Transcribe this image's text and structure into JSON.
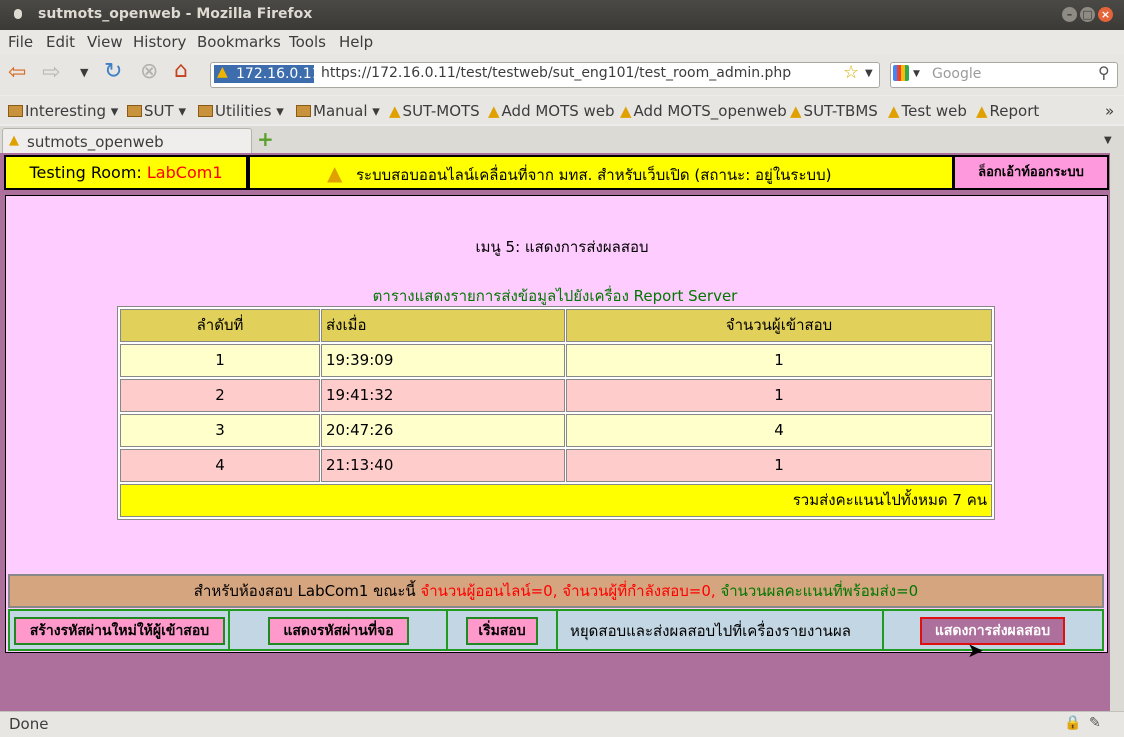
{
  "window": {
    "title": "sutmots_openweb - Mozilla Firefox"
  },
  "menubar": {
    "file": "File",
    "edit": "Edit",
    "view": "View",
    "history": "History",
    "bookmarks": "Bookmarks",
    "tools": "Tools",
    "help": "Help"
  },
  "nav": {
    "url_host": "172.16.0.11",
    "url": "https://172.16.0.11/test/testweb/sut_eng101/test_room_admin.php",
    "search_placeholder": "Google"
  },
  "bookmarks": [
    "Interesting",
    "SUT",
    "Utilities",
    "Manual",
    "SUT-MOTS",
    "Add MOTS web",
    "Add MOTS_openweb",
    "SUT-TBMS",
    "Test web",
    "Report"
  ],
  "tab": {
    "label": "sutmots_openweb"
  },
  "header": {
    "room_label": "Testing  Room:",
    "room_name": "LabCom1",
    "system_text": "ระบบสอบออนไลน์เคลื่อนที่จาก มทส. สำหรับเว็บเปิด (สถานะ: อยู่ในระบบ)",
    "logout": "ล็อกเอ้าท์ออกระบบ"
  },
  "main": {
    "menu_title": "เมนู 5: แสดงการส่งผลสอบ",
    "table_title": "ตารางแสดงรายการส่งข้อมูลไปยังเครื่อง  Report  Server",
    "columns": [
      "ลำดับที่",
      "ส่งเมื่อ",
      "จำนวนผู้เข้าสอบ"
    ],
    "rows": [
      {
        "no": "1",
        "time": "19:39:09",
        "count": "1"
      },
      {
        "no": "2",
        "time": "19:41:32",
        "count": "1"
      },
      {
        "no": "3",
        "time": "20:47:26",
        "count": "4"
      },
      {
        "no": "4",
        "time": "21:13:40",
        "count": "1"
      }
    ],
    "total": "รวมส่งคะแนนไปทั้งหมด  7  คน"
  },
  "room_status": {
    "prefix": "สำหรับห้องสอบ LabCom1 ขณะนี้",
    "online": "จำนวนผู้ออนไลน์=0,",
    "testing": "จำนวนผู้ที่กำลังสอบ=0,",
    "ready": "จำนวนผลคะแนนที่พร้อมส่ง=0"
  },
  "actions": {
    "create_pw": "สร้างรหัสผ่านใหม่ให้ผู้เข้าสอบ",
    "show_pw": "แสดงรหัสผ่านที่จอ",
    "start": "เริ่มสอบ",
    "stop": "หยุดสอบและส่งผลสอบไปที่เครื่องรายงานผล",
    "show_results": "แสดงการส่งผลสอบ"
  },
  "statusbar": {
    "text": "Done"
  },
  "colors": {
    "yellow": "#ffff00",
    "pink_panel": "#ffccff",
    "page_bg": "#ad6f9c",
    "room_red": "#ff0000",
    "green_text": "#007700"
  }
}
